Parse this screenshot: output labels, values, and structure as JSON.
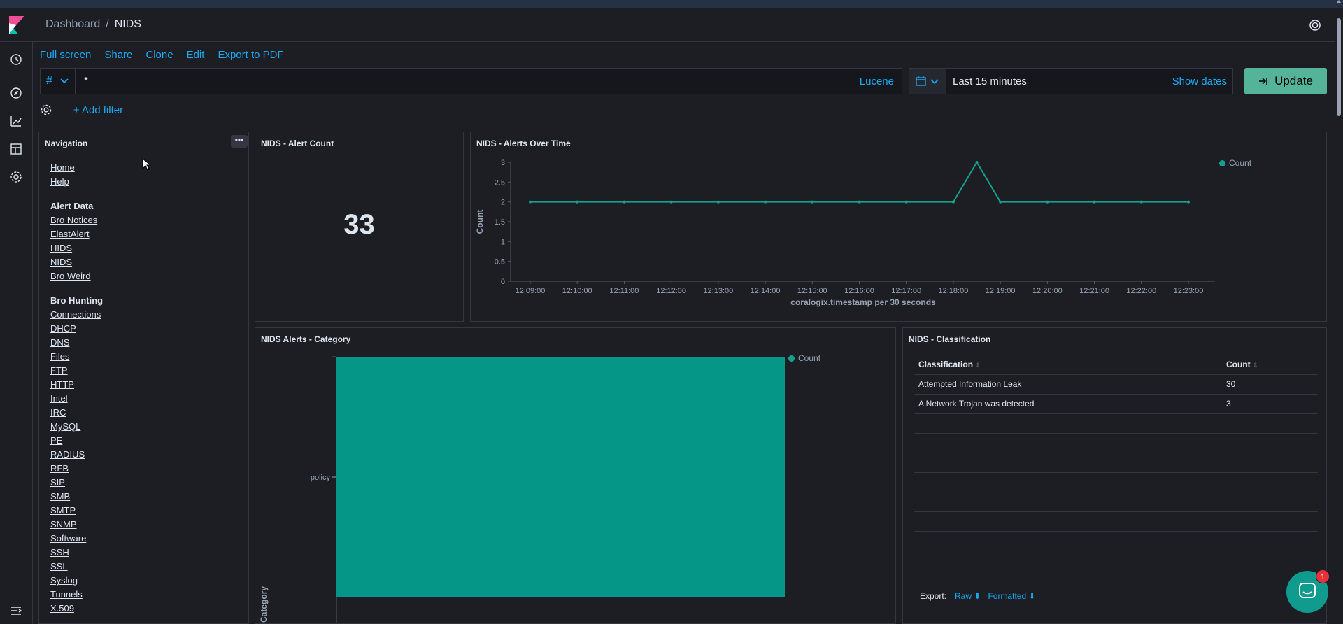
{
  "header": {
    "breadcrumb": [
      "Dashboard",
      "/",
      "NIDS"
    ]
  },
  "menu": {
    "items": [
      "Full screen",
      "Share",
      "Clone",
      "Edit",
      "Export to PDF"
    ]
  },
  "query": {
    "index_symbol": "#",
    "value": "*",
    "language": "Lucene"
  },
  "time": {
    "range": "Last 15 minutes",
    "show_dates": "Show dates",
    "update_label": "Update"
  },
  "filter": {
    "add_label": "+ Add filter"
  },
  "navigation_panel": {
    "title": "Navigation",
    "top_links": [
      "Home",
      "Help"
    ],
    "sections": [
      {
        "heading": "Alert Data",
        "links": [
          "Bro Notices",
          "ElastAlert",
          "HIDS",
          "NIDS",
          "Bro Weird"
        ]
      },
      {
        "heading": "Bro Hunting",
        "links": [
          "Connections",
          "DHCP",
          "DNS",
          "Files",
          "FTP",
          "HTTP",
          "Intel",
          "IRC",
          "MySQL",
          "PE",
          "RADIUS",
          "RFB",
          "SIP",
          "SMB",
          "SMTP",
          "SNMP",
          "Software",
          "SSH",
          "SSL",
          "Syslog",
          "Tunnels",
          "X.509"
        ]
      }
    ]
  },
  "alert_count_panel": {
    "title": "NIDS - Alert Count",
    "value": "33"
  },
  "classification_panel": {
    "title": "NIDS - Classification",
    "columns": [
      "Classification",
      "Count"
    ],
    "rows": [
      [
        "Attempted Information Leak",
        "30"
      ],
      [
        "A Network Trojan was detected",
        "3"
      ]
    ],
    "export_label": "Export:",
    "export_raw": "Raw",
    "export_formatted": "Formatted"
  },
  "chat": {
    "badge": "1"
  },
  "colors": {
    "accent": "#1ba9f5",
    "series": "#16a090",
    "update_button": "#54b399"
  },
  "chart_data": [
    {
      "type": "line",
      "title": "NIDS - Alerts Over Time",
      "xlabel": "coralogix.timestamp per 30 seconds",
      "ylabel": "Count",
      "x_ticks": [
        "12:09:00",
        "12:10:00",
        "12:11:00",
        "12:12:00",
        "12:13:00",
        "12:14:00",
        "12:15:00",
        "12:16:00",
        "12:17:00",
        "12:18:00",
        "12:19:00",
        "12:20:00",
        "12:21:00",
        "12:22:00",
        "12:23:00"
      ],
      "y_ticks": [
        "0",
        "0.5",
        "1",
        "1.5",
        "2",
        "2.5",
        "3"
      ],
      "ylim": [
        0,
        3
      ],
      "series": [
        {
          "name": "Count",
          "x": [
            "12:09:00",
            "12:10:00",
            "12:11:00",
            "12:12:00",
            "12:13:00",
            "12:14:00",
            "12:15:00",
            "12:16:00",
            "12:17:00",
            "12:18:00",
            "12:18:30",
            "12:19:00",
            "12:20:00",
            "12:21:00",
            "12:22:00",
            "12:23:00"
          ],
          "values": [
            2,
            2,
            2,
            2,
            2,
            2,
            2,
            2,
            2,
            2,
            3,
            2,
            2,
            2,
            2,
            2
          ]
        }
      ],
      "legend": "top-right"
    },
    {
      "type": "bar",
      "title": "NIDS Alerts - Category",
      "orientation": "horizontal",
      "categories": [
        "policy"
      ],
      "ylabel": "Category",
      "series": [
        {
          "name": "Count",
          "values": [
            33
          ]
        }
      ],
      "legend": "top-right"
    }
  ]
}
